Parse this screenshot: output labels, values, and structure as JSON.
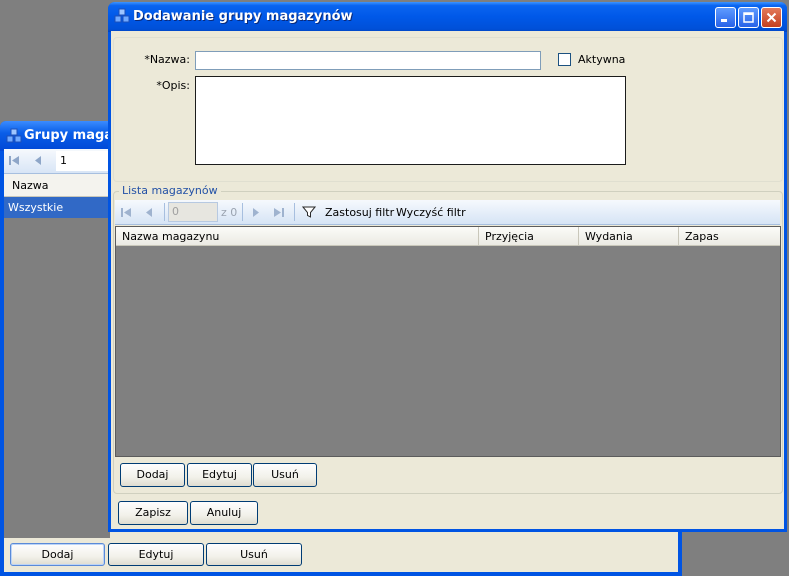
{
  "background_window": {
    "title": "Grupy magazy",
    "nav": {
      "position_value": "1"
    },
    "grid": {
      "column_header": "Nazwa",
      "rows": [
        "Wszystkie"
      ]
    },
    "buttons": {
      "add": "Dodaj",
      "edit": "Edytuj",
      "delete": "Usuń"
    }
  },
  "dialog": {
    "title": "Dodawanie grupy magazynów",
    "form": {
      "name_label": "*Nazwa:",
      "name_value": "",
      "active_label": "Aktywna",
      "active_checked": false,
      "description_label": "*Opis:",
      "description_value": ""
    },
    "warehouse_list": {
      "group_title": "Lista magazynów",
      "nav": {
        "position_value": "0",
        "total": "z 0"
      },
      "filter": {
        "apply_label": "Zastosuj filtr",
        "clear_label": "Wyczyść filtr"
      },
      "columns": [
        "Nazwa magazynu",
        "Przyjęcia",
        "Wydania",
        "Zapas"
      ],
      "rows": [],
      "buttons": {
        "add": "Dodaj",
        "edit": "Edytuj",
        "delete": "Usuń"
      }
    },
    "footer_buttons": {
      "save": "Zapisz",
      "cancel": "Anuluj"
    }
  },
  "colors": {
    "title_bar": "#0054e3",
    "window_face": "#ece9d8",
    "grid_empty": "#808080",
    "selection": "#3169c6"
  }
}
